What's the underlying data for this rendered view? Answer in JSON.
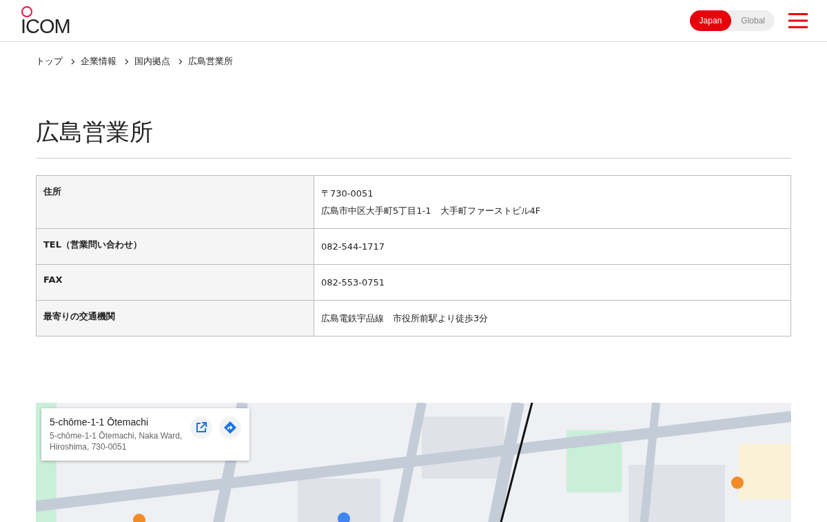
{
  "header": {
    "logo": "ICOM",
    "region_toggle": [
      {
        "label": "Japan",
        "selected": true
      },
      {
        "label": "Global",
        "selected": false
      }
    ]
  },
  "breadcrumb": [
    "トップ",
    "企業情報",
    "国内拠点",
    "広島営業所"
  ],
  "title": "広島営業所",
  "table": {
    "rows": [
      {
        "label": "住所",
        "lines": [
          "〒730-0051",
          "広島市中区大手町5丁目1-1　大手町ファーストビル4F"
        ]
      },
      {
        "label": "TEL（営業問い合わせ）",
        "lines": [
          "082-544-1717"
        ]
      },
      {
        "label": "FAX",
        "lines": [
          "082-553-0751"
        ]
      },
      {
        "label": "最寄りの交通機関",
        "lines": [
          "広島電鉄宇品線　市役所前駅より徒歩3分"
        ]
      }
    ]
  },
  "map": {
    "place_card": {
      "title": "5-chōme-1-1 Ōtemachi",
      "address": "5-chōme-1-1 Ōtemachi, Naka Ward, Hiroshima, 730-0051"
    }
  }
}
